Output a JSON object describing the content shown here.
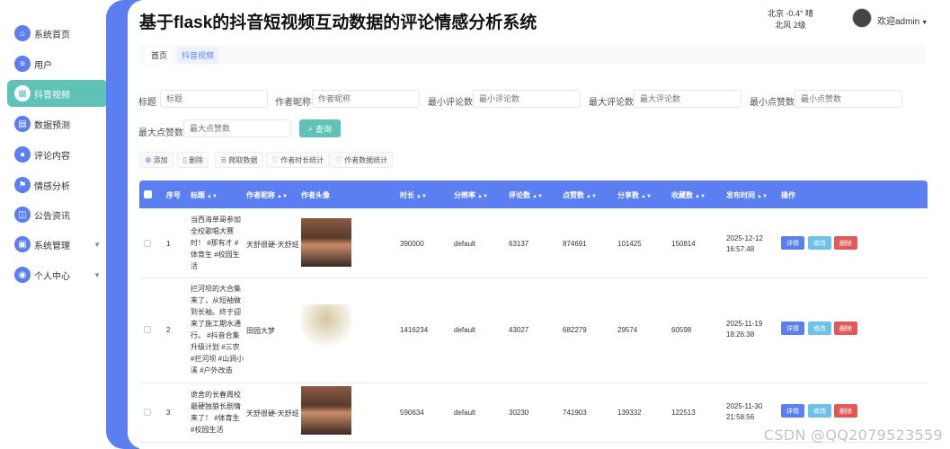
{
  "sidebar": {
    "items": [
      {
        "label": "系统首页",
        "icon": "home-icon"
      },
      {
        "label": "用户",
        "icon": "list-icon"
      },
      {
        "label": "抖音视频",
        "icon": "grid-icon"
      },
      {
        "label": "数据预测",
        "icon": "doc-icon"
      },
      {
        "label": "评论内容",
        "icon": "user-icon"
      },
      {
        "label": "情感分析",
        "icon": "flag-icon"
      },
      {
        "label": "公告资讯",
        "icon": "news-icon"
      },
      {
        "label": "系统管理",
        "icon": "lock-icon"
      },
      {
        "label": "个人中心",
        "icon": "person-icon"
      }
    ]
  },
  "header": {
    "title": "基于flask的抖音短视频互动数据的评论情感分析系统",
    "weather_line1": "北京  -0.4°  晴",
    "weather_line2": "北风  2级",
    "welcome": "欢迎admin"
  },
  "breadcrumb": {
    "home": "首页",
    "current": "抖音视频"
  },
  "filters": {
    "title_label": "标题",
    "title_placeholder": "标题",
    "author_label": "作者昵称",
    "author_placeholder": "作者昵称",
    "min_comments_label": "最小评论数",
    "min_comments_placeholder": "最小评论数",
    "max_comments_label": "最大评论数",
    "max_comments_placeholder": "最大评论数",
    "min_likes_label": "最小点赞数",
    "min_likes_placeholder": "最小点赞数",
    "max_likes_label": "最大点赞数",
    "max_likes_placeholder": "最大点赞数",
    "search_label": "查询"
  },
  "toolbar": {
    "add": "添加",
    "delete": "删除",
    "crawl": "爬取数据",
    "duration_stats": "作者时长统计",
    "author_stats": "作者数据统计"
  },
  "table": {
    "headers": {
      "index": "序号",
      "title": "标题",
      "author": "作者昵称",
      "avatar": "作者头像",
      "duration": "时长",
      "resolution": "分辨率",
      "comments": "评论数",
      "likes": "点赞数",
      "shares": "分享数",
      "collects": "收藏数",
      "published": "发布时间",
      "actions": "操作"
    },
    "rows": [
      {
        "index": "1",
        "title": "当西海单哥参加全校歌唱大赛时！ #那有才 #体育生 #校园生活",
        "author": "天舒很硬-天舒班",
        "duration": "390000",
        "resolution": "default",
        "comments": "63137",
        "likes": "874691",
        "shares": "101425",
        "collects": "150814",
        "published": "2025-12-12 16:57:48"
      },
      {
        "index": "2",
        "title": "拦河坝的大合集来了，从短袖做到长袖。终于迎来了施工期水通行。 #抖音合集升级计划 #三农 #拦河坝 #山涧小溪 #户外改造",
        "author": "田园大梦",
        "duration": "1416234",
        "resolution": "default",
        "comments": "43027",
        "likes": "682279",
        "shares": "29574",
        "collects": "60598",
        "published": "2025-11-19 18:26:38"
      },
      {
        "index": "3",
        "title": "诡舍的长春周校最硬独狼长剧情来了！ #体育生 #校园生活",
        "author": "天舒很硬-天舒班",
        "duration": "590634",
        "resolution": "default",
        "comments": "30230",
        "likes": "741903",
        "shares": "139332",
        "collects": "122513",
        "published": "2025-11-30 21:58:56"
      }
    ],
    "actions": {
      "detail": "详情",
      "edit": "修改",
      "delete": "删除"
    }
  },
  "watermark": "CSDN @QQ2079523559"
}
